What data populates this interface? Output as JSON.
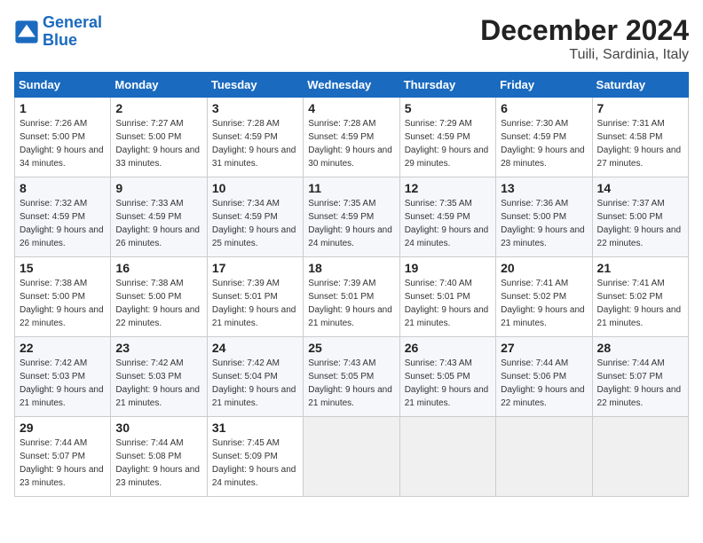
{
  "logo": {
    "line1": "General",
    "line2": "Blue"
  },
  "title": "December 2024",
  "location": "Tuili, Sardinia, Italy",
  "weekdays": [
    "Sunday",
    "Monday",
    "Tuesday",
    "Wednesday",
    "Thursday",
    "Friday",
    "Saturday"
  ],
  "weeks": [
    [
      {
        "day": "1",
        "sunrise": "7:26 AM",
        "sunset": "5:00 PM",
        "daylight": "9 hours and 34 minutes."
      },
      {
        "day": "2",
        "sunrise": "7:27 AM",
        "sunset": "5:00 PM",
        "daylight": "9 hours and 33 minutes."
      },
      {
        "day": "3",
        "sunrise": "7:28 AM",
        "sunset": "4:59 PM",
        "daylight": "9 hours and 31 minutes."
      },
      {
        "day": "4",
        "sunrise": "7:28 AM",
        "sunset": "4:59 PM",
        "daylight": "9 hours and 30 minutes."
      },
      {
        "day": "5",
        "sunrise": "7:29 AM",
        "sunset": "4:59 PM",
        "daylight": "9 hours and 29 minutes."
      },
      {
        "day": "6",
        "sunrise": "7:30 AM",
        "sunset": "4:59 PM",
        "daylight": "9 hours and 28 minutes."
      },
      {
        "day": "7",
        "sunrise": "7:31 AM",
        "sunset": "4:58 PM",
        "daylight": "9 hours and 27 minutes."
      }
    ],
    [
      {
        "day": "8",
        "sunrise": "7:32 AM",
        "sunset": "4:59 PM",
        "daylight": "9 hours and 26 minutes."
      },
      {
        "day": "9",
        "sunrise": "7:33 AM",
        "sunset": "4:59 PM",
        "daylight": "9 hours and 26 minutes."
      },
      {
        "day": "10",
        "sunrise": "7:34 AM",
        "sunset": "4:59 PM",
        "daylight": "9 hours and 25 minutes."
      },
      {
        "day": "11",
        "sunrise": "7:35 AM",
        "sunset": "4:59 PM",
        "daylight": "9 hours and 24 minutes."
      },
      {
        "day": "12",
        "sunrise": "7:35 AM",
        "sunset": "4:59 PM",
        "daylight": "9 hours and 24 minutes."
      },
      {
        "day": "13",
        "sunrise": "7:36 AM",
        "sunset": "5:00 PM",
        "daylight": "9 hours and 23 minutes."
      },
      {
        "day": "14",
        "sunrise": "7:37 AM",
        "sunset": "5:00 PM",
        "daylight": "9 hours and 22 minutes."
      }
    ],
    [
      {
        "day": "15",
        "sunrise": "7:38 AM",
        "sunset": "5:00 PM",
        "daylight": "9 hours and 22 minutes."
      },
      {
        "day": "16",
        "sunrise": "7:38 AM",
        "sunset": "5:00 PM",
        "daylight": "9 hours and 22 minutes."
      },
      {
        "day": "17",
        "sunrise": "7:39 AM",
        "sunset": "5:01 PM",
        "daylight": "9 hours and 21 minutes."
      },
      {
        "day": "18",
        "sunrise": "7:39 AM",
        "sunset": "5:01 PM",
        "daylight": "9 hours and 21 minutes."
      },
      {
        "day": "19",
        "sunrise": "7:40 AM",
        "sunset": "5:01 PM",
        "daylight": "9 hours and 21 minutes."
      },
      {
        "day": "20",
        "sunrise": "7:41 AM",
        "sunset": "5:02 PM",
        "daylight": "9 hours and 21 minutes."
      },
      {
        "day": "21",
        "sunrise": "7:41 AM",
        "sunset": "5:02 PM",
        "daylight": "9 hours and 21 minutes."
      }
    ],
    [
      {
        "day": "22",
        "sunrise": "7:42 AM",
        "sunset": "5:03 PM",
        "daylight": "9 hours and 21 minutes."
      },
      {
        "day": "23",
        "sunrise": "7:42 AM",
        "sunset": "5:03 PM",
        "daylight": "9 hours and 21 minutes."
      },
      {
        "day": "24",
        "sunrise": "7:42 AM",
        "sunset": "5:04 PM",
        "daylight": "9 hours and 21 minutes."
      },
      {
        "day": "25",
        "sunrise": "7:43 AM",
        "sunset": "5:05 PM",
        "daylight": "9 hours and 21 minutes."
      },
      {
        "day": "26",
        "sunrise": "7:43 AM",
        "sunset": "5:05 PM",
        "daylight": "9 hours and 21 minutes."
      },
      {
        "day": "27",
        "sunrise": "7:44 AM",
        "sunset": "5:06 PM",
        "daylight": "9 hours and 22 minutes."
      },
      {
        "day": "28",
        "sunrise": "7:44 AM",
        "sunset": "5:07 PM",
        "daylight": "9 hours and 22 minutes."
      }
    ],
    [
      {
        "day": "29",
        "sunrise": "7:44 AM",
        "sunset": "5:07 PM",
        "daylight": "9 hours and 23 minutes."
      },
      {
        "day": "30",
        "sunrise": "7:44 AM",
        "sunset": "5:08 PM",
        "daylight": "9 hours and 23 minutes."
      },
      {
        "day": "31",
        "sunrise": "7:45 AM",
        "sunset": "5:09 PM",
        "daylight": "9 hours and 24 minutes."
      },
      null,
      null,
      null,
      null
    ]
  ]
}
